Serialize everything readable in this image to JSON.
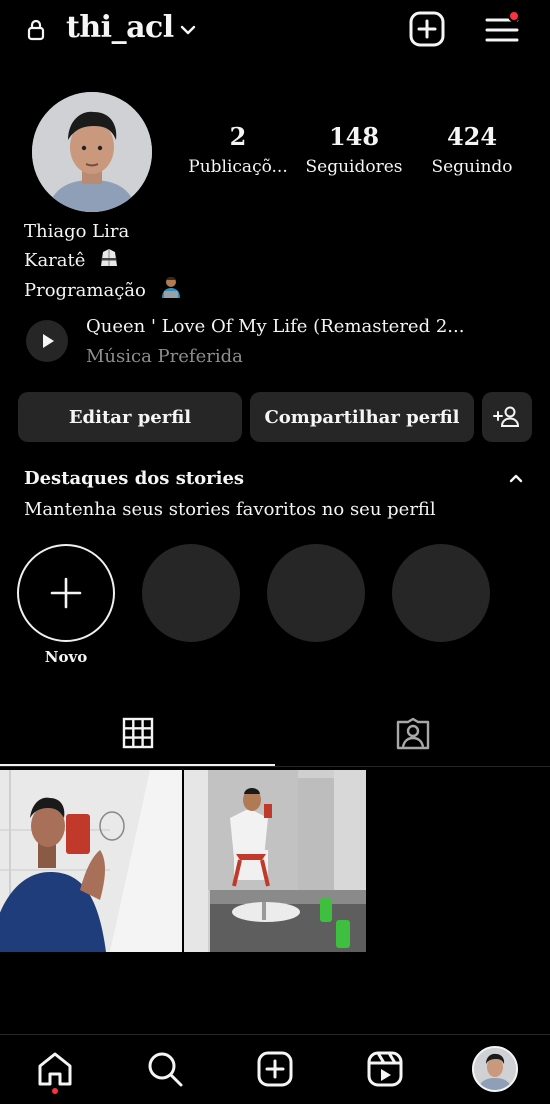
{
  "header": {
    "username": "thi_acl"
  },
  "profile": {
    "stats": [
      {
        "value": "2",
        "label": "Publicaçõ..."
      },
      {
        "value": "148",
        "label": "Seguidores"
      },
      {
        "value": "424",
        "label": "Seguindo"
      }
    ],
    "name": "Thiago Lira",
    "bio_lines": [
      "Karatê",
      "Programação"
    ],
    "music": {
      "title": "Queen ' Love Of My Life (Remastered 2...",
      "subtitle": "Música Preferida"
    }
  },
  "buttons": {
    "edit": "Editar perfil",
    "share": "Compartilhar perfil"
  },
  "highlights": {
    "title": "Destaques dos stories",
    "subtitle": "Mantenha seus stories favoritos no seu perfil",
    "new_label": "Novo"
  },
  "nav": {
    "items": [
      "home-icon",
      "search-icon",
      "create-icon",
      "reels-icon",
      "profile-avatar"
    ]
  },
  "colors": {
    "background": "#000000",
    "surface": "#262626",
    "notification": "#ff3040",
    "muted_text": "#8e8e8e"
  }
}
